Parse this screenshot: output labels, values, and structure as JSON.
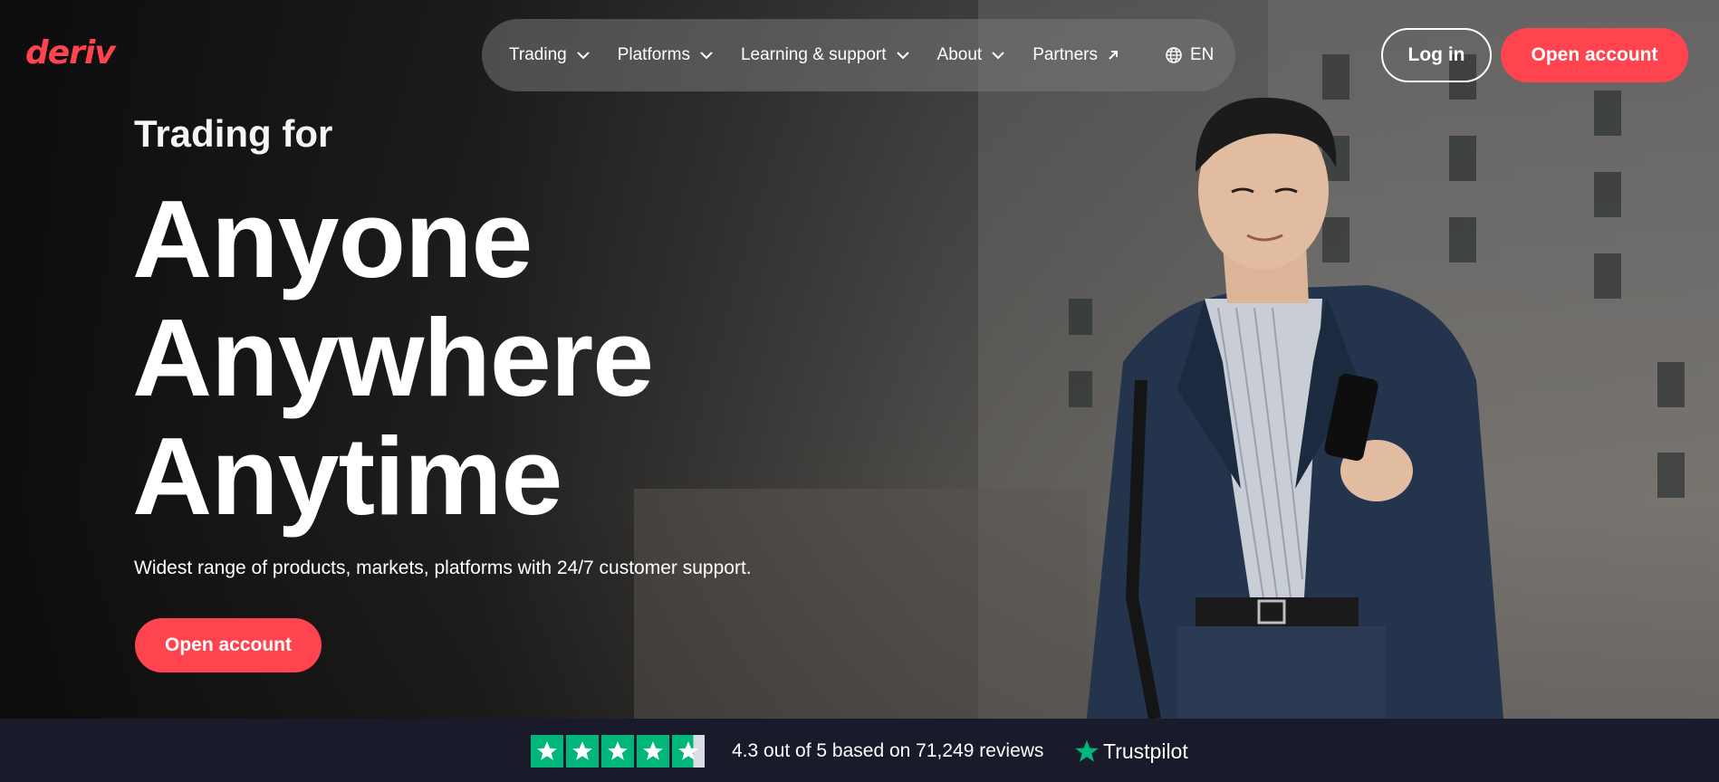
{
  "header": {
    "logo": "deriv",
    "nav": [
      {
        "label": "Trading",
        "icon": "chevron-down-icon"
      },
      {
        "label": "Platforms",
        "icon": "chevron-down-icon"
      },
      {
        "label": "Learning & support",
        "icon": "chevron-down-icon"
      },
      {
        "label": "About",
        "icon": "chevron-down-icon"
      },
      {
        "label": "Partners",
        "icon": "arrow-up-right-icon"
      }
    ],
    "language": {
      "label": "EN",
      "icon": "globe-icon"
    },
    "login_label": "Log in",
    "open_account_label": "Open account"
  },
  "hero": {
    "eyebrow": "Trading for",
    "lines": [
      "Anyone",
      "Anywhere",
      "Anytime"
    ],
    "subtitle": "Widest range of products, markets, platforms with 24/7 customer support.",
    "cta_label": "Open account"
  },
  "trust": {
    "stars": 4.3,
    "rating_text": "4.3 out of 5 based on 71,249 reviews",
    "brand": "Trustpilot"
  },
  "colors": {
    "brand_red": "#ff444f",
    "trustpilot_green": "#00b67a",
    "footer_bg": "#1a1b2a"
  }
}
